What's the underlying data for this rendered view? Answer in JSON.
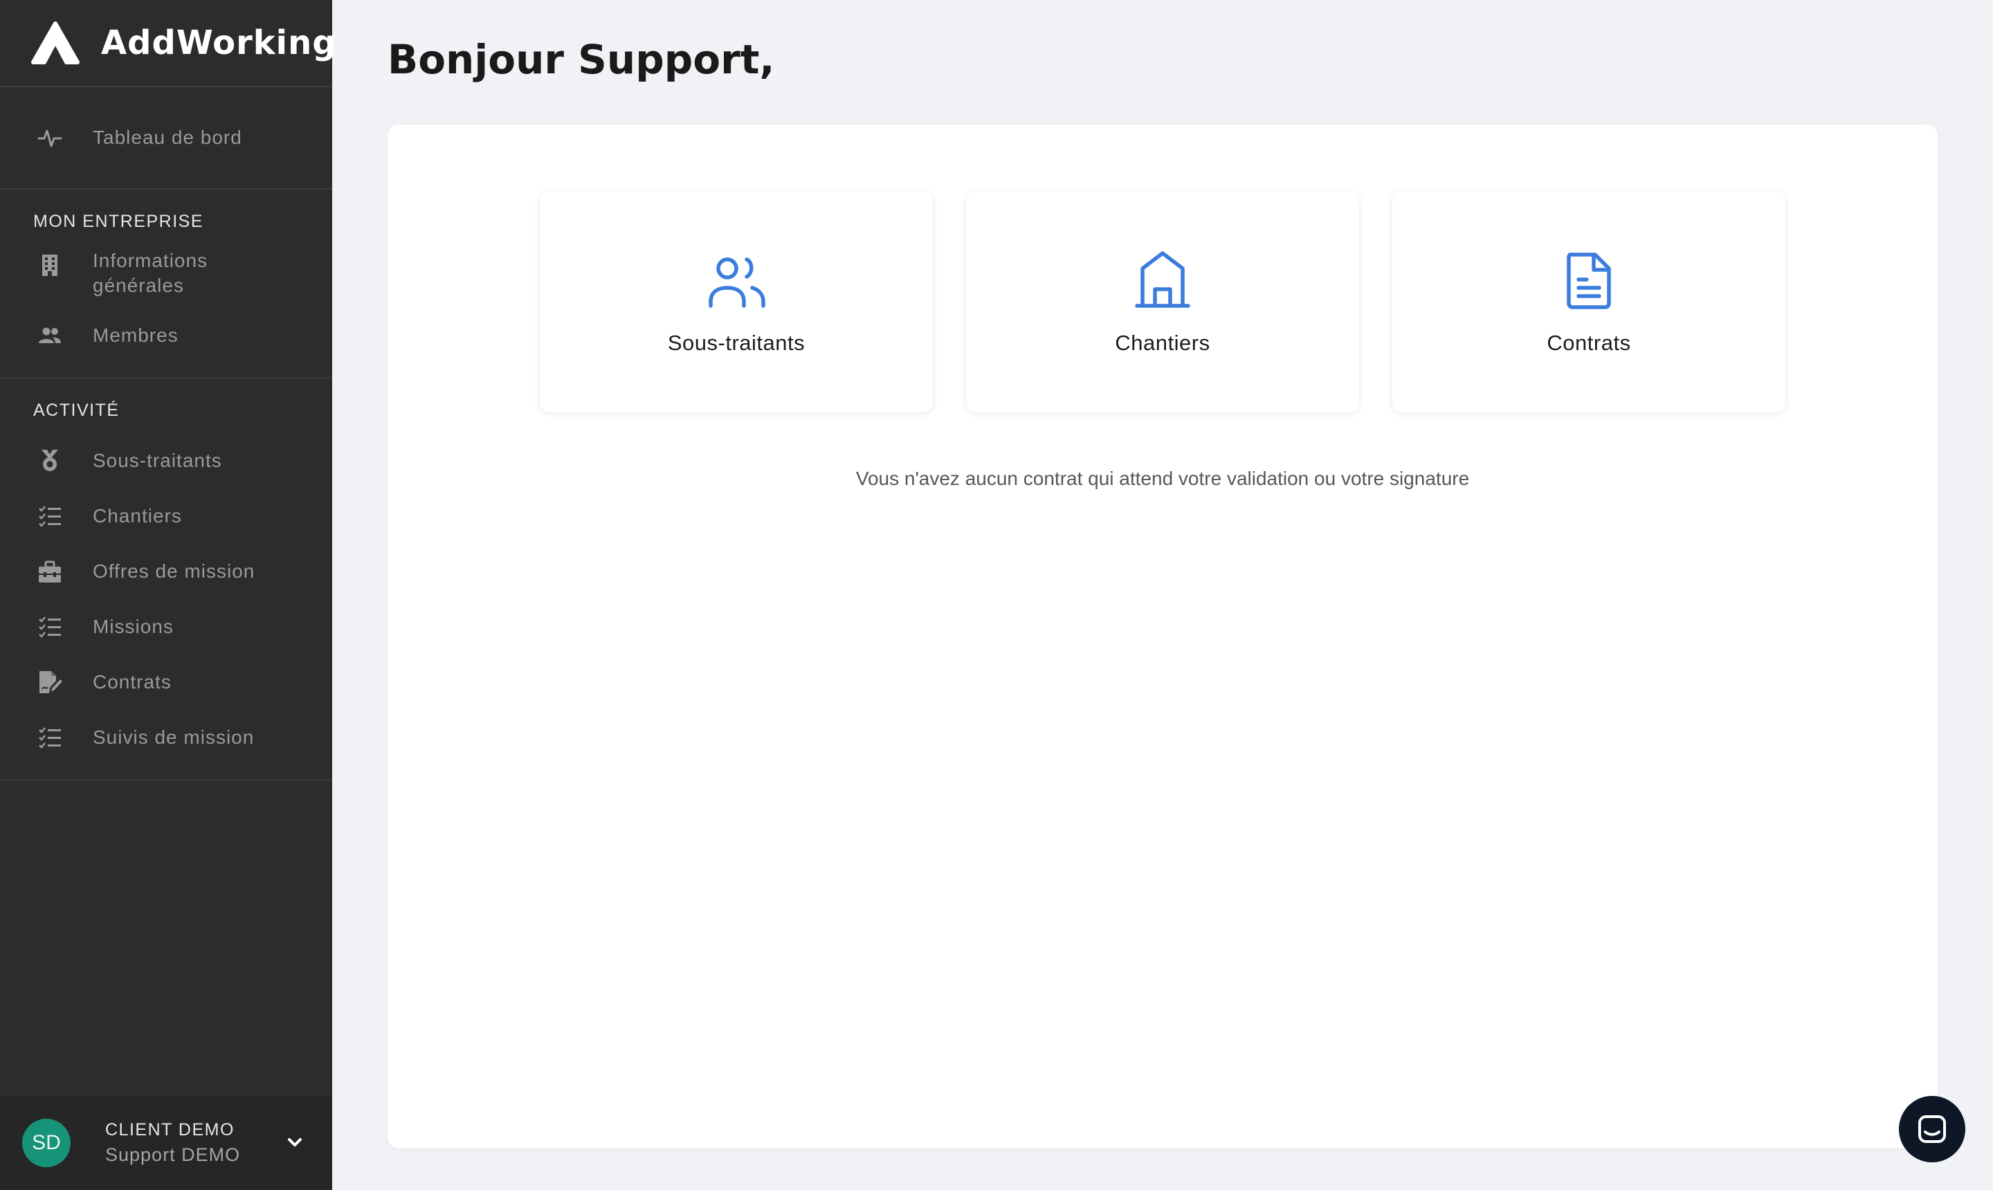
{
  "brand": {
    "name": "AddWorking",
    "logo_icon": "addworking-logo-icon"
  },
  "sidebar": {
    "dashboard": {
      "label": "Tableau de bord",
      "icon": "activity-icon"
    },
    "sections": [
      {
        "title": "MON ENTREPRISE",
        "items": [
          {
            "label": "Informations générales",
            "line1": "Informations",
            "line2": "générales",
            "icon": "building-icon"
          },
          {
            "label": "Membres",
            "icon": "users-icon"
          }
        ]
      },
      {
        "title": "ACTIVITÉ",
        "items": [
          {
            "label": "Sous-traitants",
            "icon": "medal-icon"
          },
          {
            "label": "Chantiers",
            "icon": "checklist-icon"
          },
          {
            "label": "Offres de mission",
            "icon": "toolbox-icon"
          },
          {
            "label": "Missions",
            "icon": "checklist-icon"
          },
          {
            "label": "Contrats",
            "icon": "file-signature-icon"
          },
          {
            "label": "Suivis de mission",
            "icon": "checklist-icon"
          }
        ]
      }
    ],
    "user": {
      "initials": "SD",
      "company": "CLIENT DEMO",
      "name": "Support DEMO",
      "avatar_color": "#17937a"
    }
  },
  "main": {
    "greeting": "Bonjour Support,",
    "cards": [
      {
        "label": "Sous-traitants",
        "icon": "users-outline-icon"
      },
      {
        "label": "Chantiers",
        "icon": "house-outline-icon"
      },
      {
        "label": "Contrats",
        "icon": "document-outline-icon"
      }
    ],
    "empty_message": "Vous n'avez aucun contrat qui attend votre validation ou votre signature"
  },
  "colors": {
    "sidebar_bg": "#2c2c2c",
    "accent_blue": "#3b7ddd",
    "page_bg": "#f1f2f5",
    "chat_button": "#0d1726"
  },
  "chat": {
    "icon": "chat-icon"
  }
}
